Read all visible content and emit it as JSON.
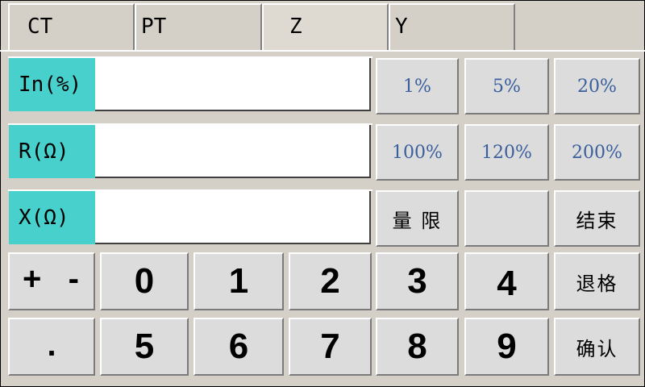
{
  "tabs": [
    "CT",
    "PT",
    "Z",
    "Y"
  ],
  "fields": [
    {
      "label": "In(%)",
      "value": ""
    },
    {
      "label": "R(Ω)",
      "value": ""
    },
    {
      "label": "X(Ω)",
      "value": ""
    }
  ],
  "presets": [
    "1%",
    "5%",
    "20%",
    "100%",
    "120%",
    "200%"
  ],
  "actions": {
    "range": "量 限",
    "blank": "",
    "end": "结束",
    "backspace": "退格",
    "confirm": "确认"
  },
  "keys": {
    "plus": "+",
    "minus": "-",
    "dot": ".",
    "row1": [
      "0",
      "1",
      "2",
      "3",
      "4"
    ],
    "row2": [
      "5",
      "6",
      "7",
      "8",
      "9"
    ]
  },
  "colors": {
    "label_bg": "#48d1cc",
    "preset_text": "#3a5f9c",
    "panel_bg": "#d4d0c8"
  }
}
